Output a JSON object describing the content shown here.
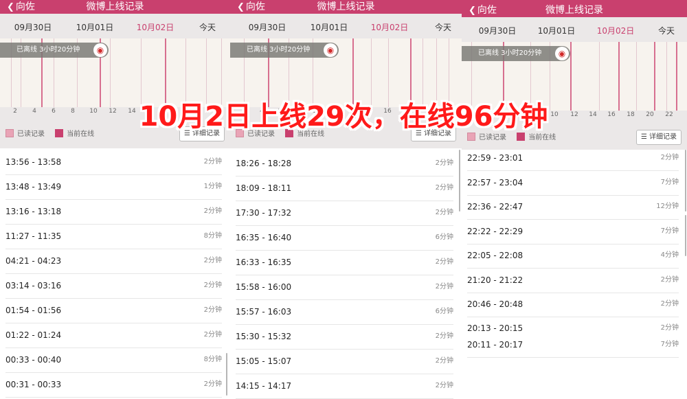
{
  "header": {
    "back_label": "向佐",
    "title": "微博上线记录"
  },
  "date_tabs": [
    "09月30日",
    "10月01日",
    "10月02日",
    "今天"
  ],
  "active_tab": "10月02日",
  "offline_status": "已离线 3小时20分钟",
  "weibo_icon": "weibo-icon",
  "legend": {
    "read": "已读记录",
    "current": "当前在线"
  },
  "detail_button": "详细记录",
  "detail_icon": "list-icon",
  "colors": {
    "brand": "#c9406e",
    "read_swatch": "#e9a4b6",
    "overlay_text": "#ff1a1a"
  },
  "panels": [
    {
      "axis_labels": [
        "2",
        "4",
        "6",
        "8",
        "10",
        "12",
        "14"
      ],
      "rows": [
        {
          "range": "13:56 - 13:58",
          "dur": "2分钟"
        },
        {
          "range": "13:48 - 13:49",
          "dur": "1分钟"
        },
        {
          "range": "13:16 - 13:18",
          "dur": "2分钟"
        },
        {
          "range": "11:27 - 11:35",
          "dur": "8分钟"
        },
        {
          "range": "04:21 - 04:23",
          "dur": "2分钟"
        },
        {
          "range": "03:14 - 03:16",
          "dur": "2分钟"
        },
        {
          "range": "01:54 - 01:56",
          "dur": "2分钟"
        },
        {
          "range": "01:22 - 01:24",
          "dur": "2分钟"
        },
        {
          "range": "00:33 - 00:40",
          "dur": "8分钟"
        },
        {
          "range": "00:31 - 00:33",
          "dur": "2分钟"
        }
      ]
    },
    {
      "axis_labels": [
        "2",
        "4",
        "6",
        "8",
        "10",
        "12",
        "14",
        "16",
        "18"
      ],
      "rows": [
        {
          "range": "18:26 - 18:28",
          "dur": "2分钟"
        },
        {
          "range": "18:09 - 18:11",
          "dur": "2分钟"
        },
        {
          "range": "17:30 - 17:32",
          "dur": "2分钟"
        },
        {
          "range": "16:35 - 16:40",
          "dur": "6分钟"
        },
        {
          "range": "16:33 - 16:35",
          "dur": "2分钟"
        },
        {
          "range": "15:58 - 16:00",
          "dur": "2分钟"
        },
        {
          "range": "15:57 - 16:03",
          "dur": "6分钟"
        },
        {
          "range": "15:30 - 15:32",
          "dur": "2分钟"
        },
        {
          "range": "15:05 - 15:07",
          "dur": "2分钟"
        },
        {
          "range": "14:15 - 14:17",
          "dur": "2分钟"
        }
      ]
    },
    {
      "axis_labels": [
        "2",
        "4",
        "6",
        "8",
        "10",
        "12",
        "14",
        "16",
        "18",
        "20",
        "22"
      ],
      "rows": [
        {
          "range": "22:59 - 23:01",
          "dur": "2分钟"
        },
        {
          "range": "22:57 - 23:04",
          "dur": "7分钟"
        },
        {
          "range": "22:36 - 22:47",
          "dur": "12分钟"
        },
        {
          "range": "22:22 - 22:29",
          "dur": "7分钟"
        },
        {
          "range": "22:05 - 22:08",
          "dur": "4分钟"
        },
        {
          "range": "21:20 - 21:22",
          "dur": "2分钟"
        },
        {
          "range": "20:46 - 20:48",
          "dur": "2分钟"
        },
        {
          "range": "20:13 - 20:15",
          "dur": "2分钟"
        },
        {
          "range": "20:11 - 20:17",
          "dur": "7分钟"
        }
      ]
    }
  ],
  "overlay_caption": "10月2日上线29次，在线96分钟"
}
